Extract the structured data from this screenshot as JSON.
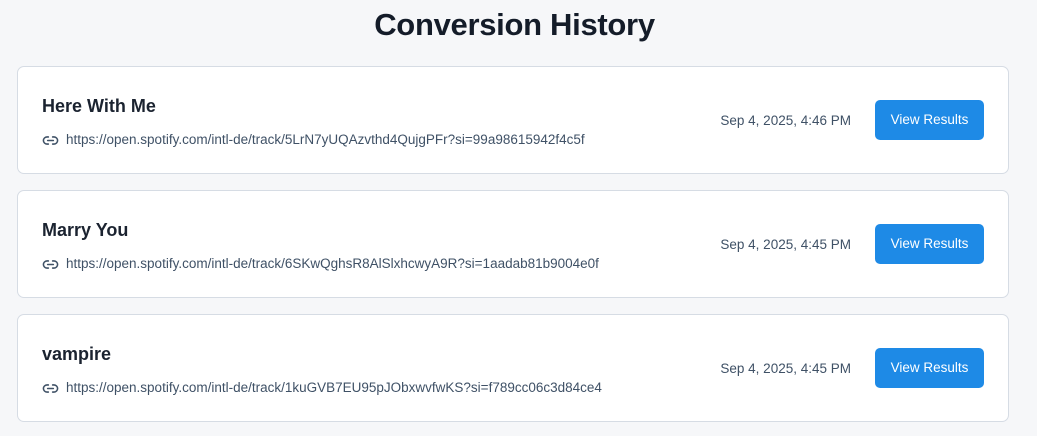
{
  "page": {
    "title": "Conversion History"
  },
  "history": [
    {
      "title": "Here With Me",
      "url": "https://open.spotify.com/intl-de/track/5LrN7yUQAzvthd4QujgPFr?si=99a98615942f4c5f",
      "date": "Sep 4, 2025, 4:46 PM",
      "button_label": "View Results",
      "link_icon": "link-icon"
    },
    {
      "title": "Marry You",
      "url": "https://open.spotify.com/intl-de/track/6SKwQghsR8AlSlxhcwyA9R?si=1aadab81b9004e0f",
      "date": "Sep 4, 2025, 4:45 PM",
      "button_label": "View Results",
      "link_icon": "link-icon"
    },
    {
      "title": "vampire",
      "url": "https://open.spotify.com/intl-de/track/1kuGVB7EU95pJObxwvfwKS?si=f789cc06c3d84ce4",
      "date": "Sep 4, 2025, 4:45 PM",
      "button_label": "View Results",
      "link_icon": "link-icon"
    }
  ],
  "colors": {
    "accent": "#1e8ae6",
    "background": "#f6f7f9",
    "card_border": "#d6dce4",
    "muted_text": "#3f5166"
  }
}
